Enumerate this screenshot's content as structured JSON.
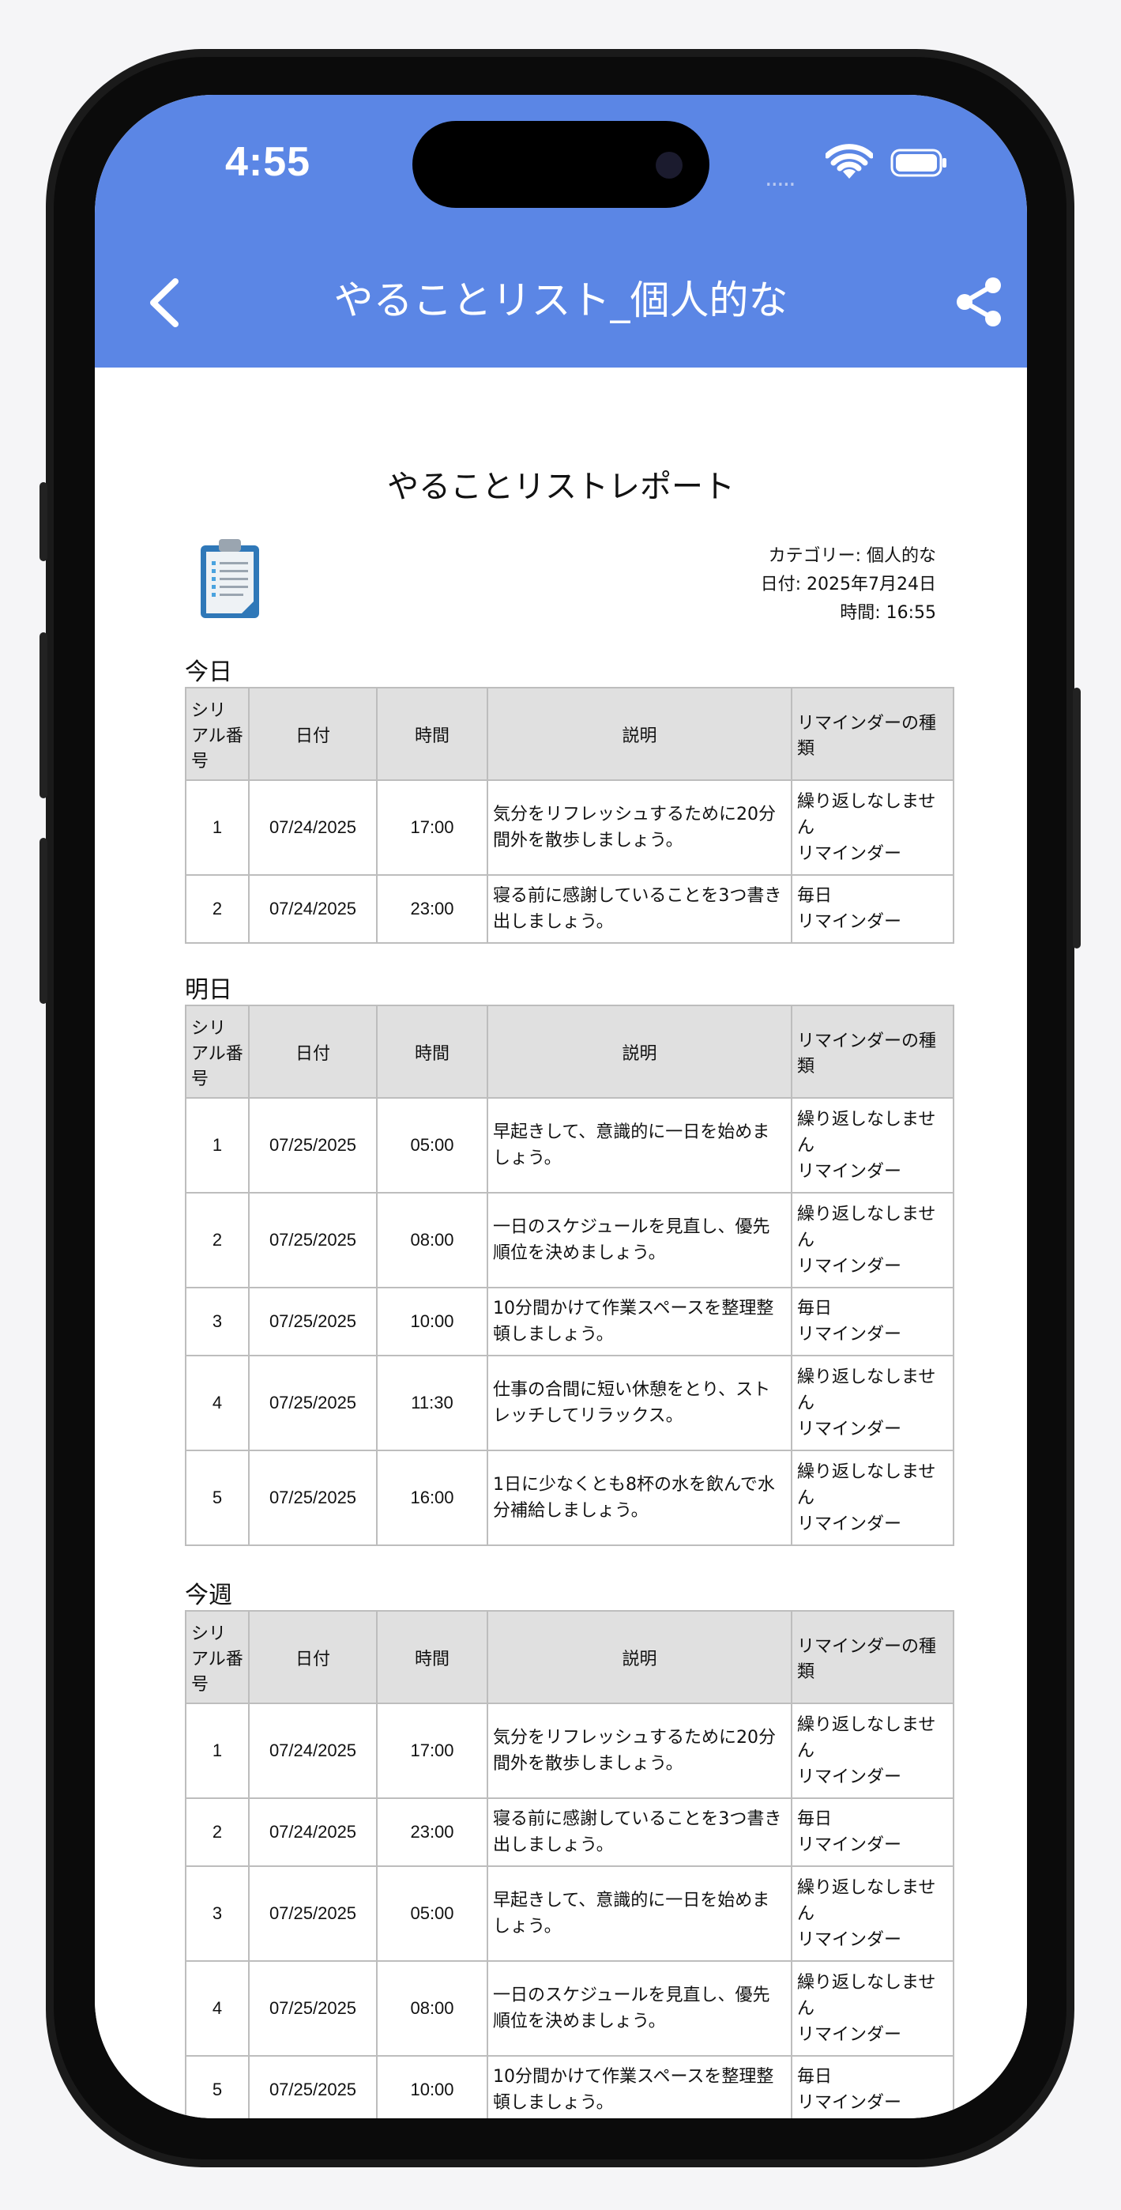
{
  "status_bar": {
    "time": "4:55",
    "signal": "....."
  },
  "nav": {
    "title": "やることリスト_個人的な"
  },
  "report": {
    "title": "やることリストレポート",
    "category": "カテゴリー: 個人的な",
    "date": "日付: 2025年7月24日",
    "time": "時間: 16:55"
  },
  "columns": {
    "serial": "シリアル番号",
    "date": "日付",
    "time": "時間",
    "description": "説明",
    "reminder": "リマインダーの種類"
  },
  "sections": [
    {
      "label": "今日",
      "rows": [
        {
          "serial": "1",
          "date": "07/24/2025",
          "time": "17:00",
          "description": "気分をリフレッシュするために20分間外を散歩しましょう。",
          "repeat": "繰り返しなしません",
          "reminder": "リマインダー"
        },
        {
          "serial": "2",
          "date": "07/24/2025",
          "time": "23:00",
          "description": "寝る前に感謝していることを3つ書き出しましょう。",
          "repeat": "毎日",
          "reminder": "リマインダー"
        }
      ]
    },
    {
      "label": "明日",
      "rows": [
        {
          "serial": "1",
          "date": "07/25/2025",
          "time": "05:00",
          "description": "早起きして、意識的に一日を始めましょう。",
          "repeat": "繰り返しなしません",
          "reminder": "リマインダー"
        },
        {
          "serial": "2",
          "date": "07/25/2025",
          "time": "08:00",
          "description": "一日のスケジュールを見直し、優先順位を決めましょう。",
          "repeat": "繰り返しなしません",
          "reminder": "リマインダー"
        },
        {
          "serial": "3",
          "date": "07/25/2025",
          "time": "10:00",
          "description": "10分間かけて作業スペースを整理整頓しましょう。",
          "repeat": "毎日",
          "reminder": "リマインダー"
        },
        {
          "serial": "4",
          "date": "07/25/2025",
          "time": "11:30",
          "description": "仕事の合間に短い休憩をとり、ストレッチしてリラックス。",
          "repeat": "繰り返しなしません",
          "reminder": "リマインダー"
        },
        {
          "serial": "5",
          "date": "07/25/2025",
          "time": "16:00",
          "description": "1日に少なくとも8杯の水を飲んで水分補給しましょう。",
          "repeat": "繰り返しなしません",
          "reminder": "リマインダー"
        }
      ]
    },
    {
      "label": "今週",
      "rows": [
        {
          "serial": "1",
          "date": "07/24/2025",
          "time": "17:00",
          "description": "気分をリフレッシュするために20分間外を散歩しましょう。",
          "repeat": "繰り返しなしません",
          "reminder": "リマインダー"
        },
        {
          "serial": "2",
          "date": "07/24/2025",
          "time": "23:00",
          "description": "寝る前に感謝していることを3つ書き出しましょう。",
          "repeat": "毎日",
          "reminder": "リマインダー"
        },
        {
          "serial": "3",
          "date": "07/25/2025",
          "time": "05:00",
          "description": "早起きして、意識的に一日を始めましょう。",
          "repeat": "繰り返しなしません",
          "reminder": "リマインダー"
        },
        {
          "serial": "4",
          "date": "07/25/2025",
          "time": "08:00",
          "description": "一日のスケジュールを見直し、優先順位を決めましょう。",
          "repeat": "繰り返しなしません",
          "reminder": "リマインダー"
        },
        {
          "serial": "5",
          "date": "07/25/2025",
          "time": "10:00",
          "description": "10分間かけて作業スペースを整理整頓しましょう。",
          "repeat": "毎日",
          "reminder": "リマインダー"
        }
      ]
    }
  ],
  "colors": {
    "header": "#5b86e5",
    "table_header": "#e0e0e0",
    "border": "#bdbdbd"
  },
  "icons": {
    "back": "chevron-left-icon",
    "share": "share-icon",
    "report": "clipboard-icon"
  }
}
